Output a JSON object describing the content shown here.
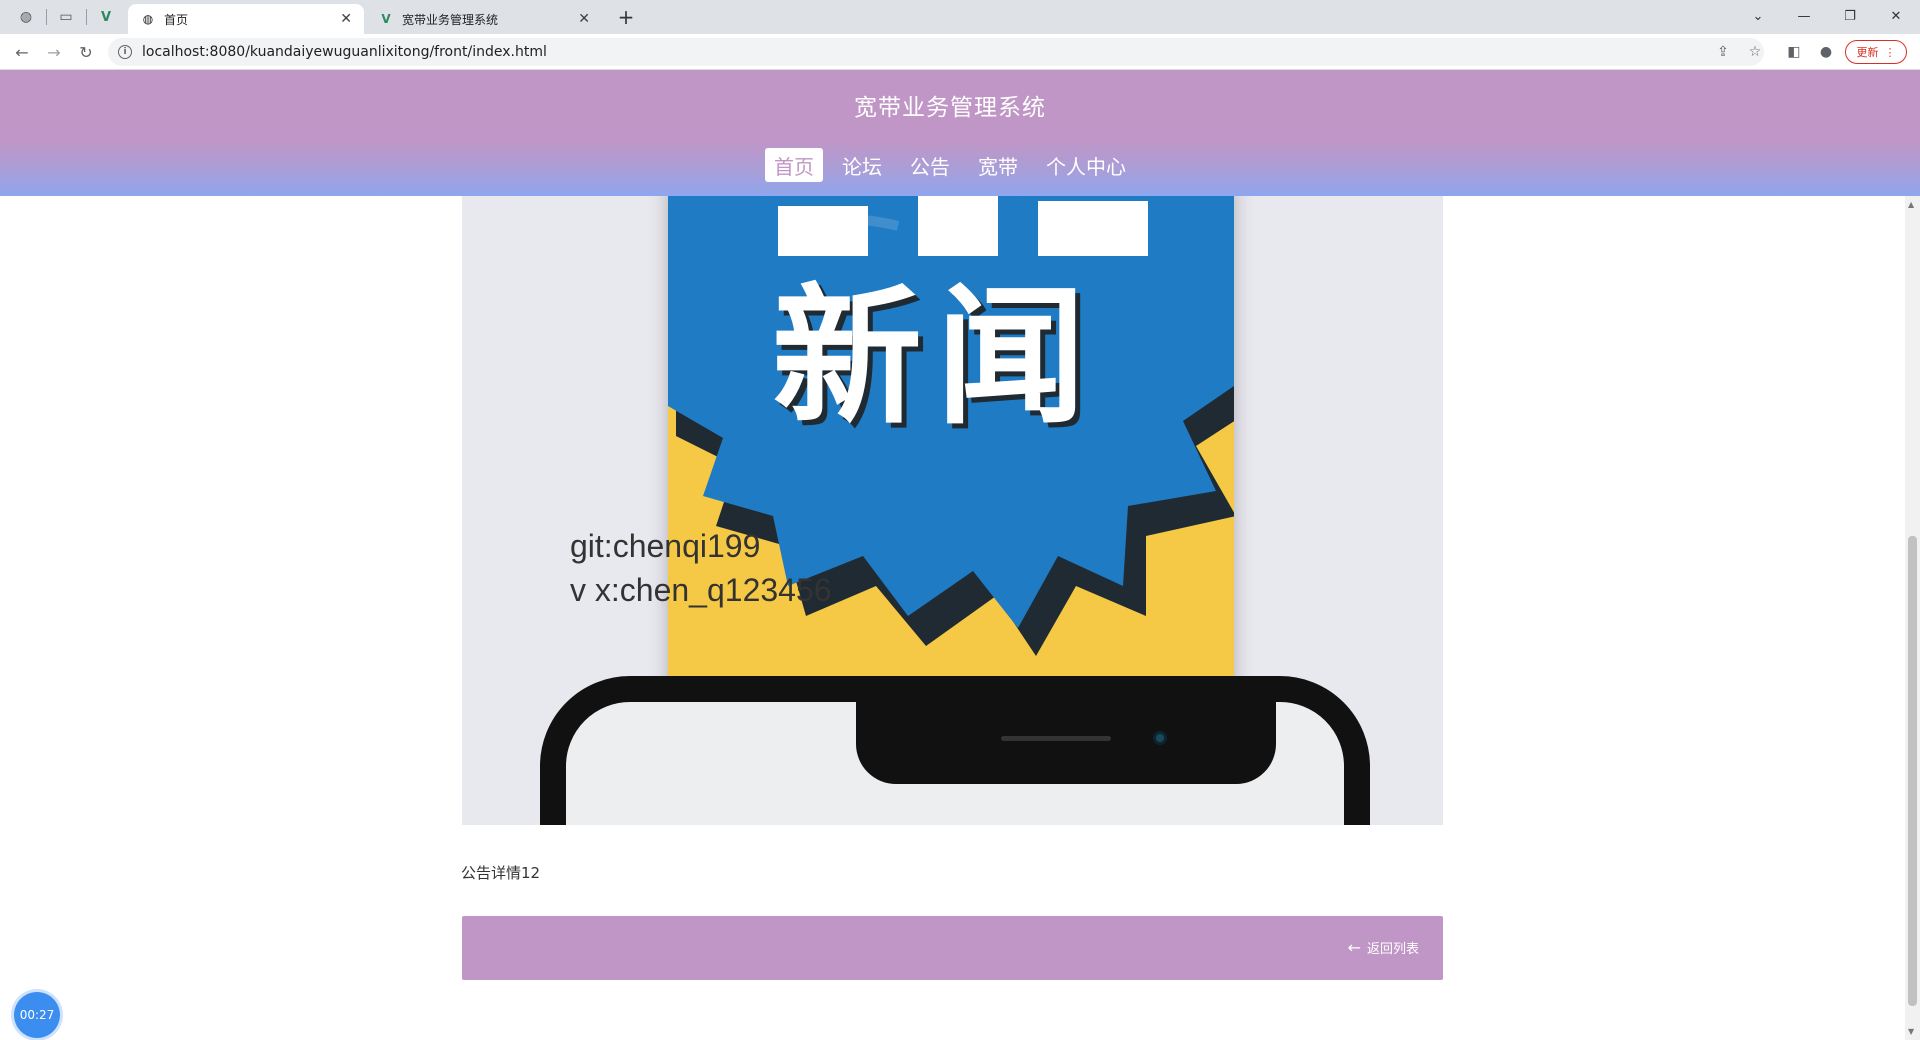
{
  "browser": {
    "tabs": [
      {
        "title": "首页",
        "active": true
      },
      {
        "title": "宽带业务管理系统",
        "active": false
      }
    ],
    "url": "localhost:8080/kuandaiyewuguanlixitong/front/index.html",
    "update_label": "更新"
  },
  "site": {
    "title": "宽带业务管理系统",
    "nav": [
      "首页",
      "论坛",
      "公告",
      "宽带",
      "个人中心"
    ],
    "active_nav": "首页"
  },
  "article": {
    "image_text": {
      "line1": "git:chenqi199",
      "line2": "v x:chen_q123456",
      "poster_headline": "新闻"
    },
    "detail": "公告详情12",
    "prev_label": "",
    "back_label": "返回列表"
  },
  "timer": "00:27",
  "colors": {
    "header_purple": "#c096c6",
    "header_blue": "#8fa6ee",
    "poster_yellow": "#f5c945",
    "poster_blue": "#1f7bc4"
  },
  "icons": {
    "back": "arrow-left-icon",
    "reload": "reload-icon",
    "star": "star-icon",
    "info": "info-icon"
  }
}
